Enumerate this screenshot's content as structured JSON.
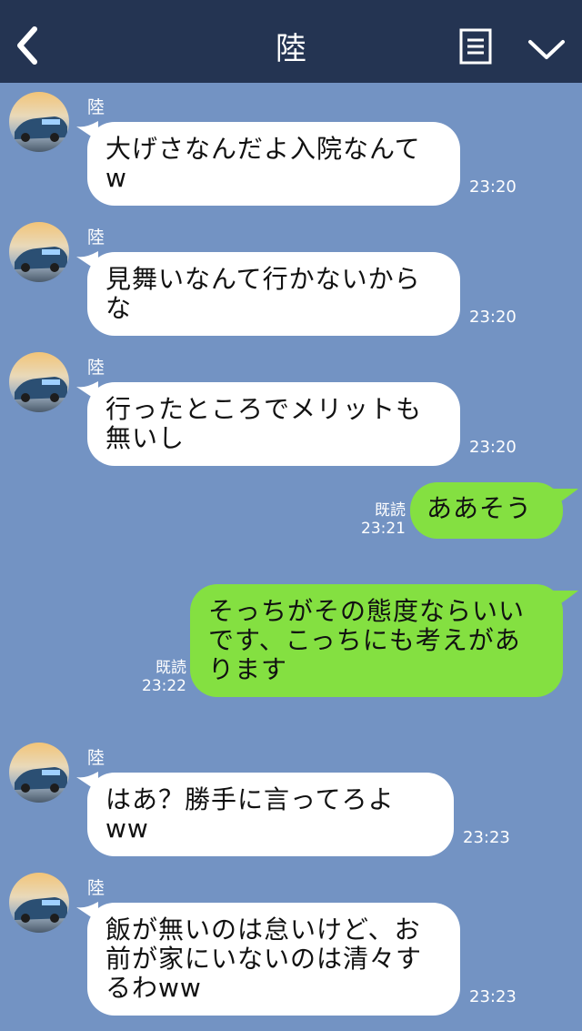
{
  "header": {
    "title": "陸"
  },
  "icons": {
    "back": "chevron-left-icon",
    "notes": "notes-icon",
    "menu": "chevron-down-icon"
  },
  "colors": {
    "header_bg": "#243452",
    "chat_bg": "#7393c3",
    "outgoing": "#84e041",
    "incoming": "#ffffff"
  },
  "messages": [
    {
      "sender": "陸",
      "text": "大げさなんだよ入院なんてw",
      "time": "23:20"
    },
    {
      "sender": "陸",
      "text": "見舞いなんて行かないからな",
      "time": "23:20"
    },
    {
      "sender": "陸",
      "text": "行ったところでメリットも無いし",
      "time": "23:20"
    },
    {
      "text": "ああそう",
      "read": "既読",
      "time": "23:21"
    },
    {
      "text": "そっちがその態度ならいいです、こっちにも考えがあります",
      "read": "既読",
      "time": "23:22"
    },
    {
      "sender": "陸",
      "text": "はあ？勝手に言ってろよww",
      "time": "23:23"
    },
    {
      "sender": "陸",
      "text": "飯が無いのは怠いけど、お前が家にいないのは清々するわww",
      "time": "23:23"
    }
  ]
}
